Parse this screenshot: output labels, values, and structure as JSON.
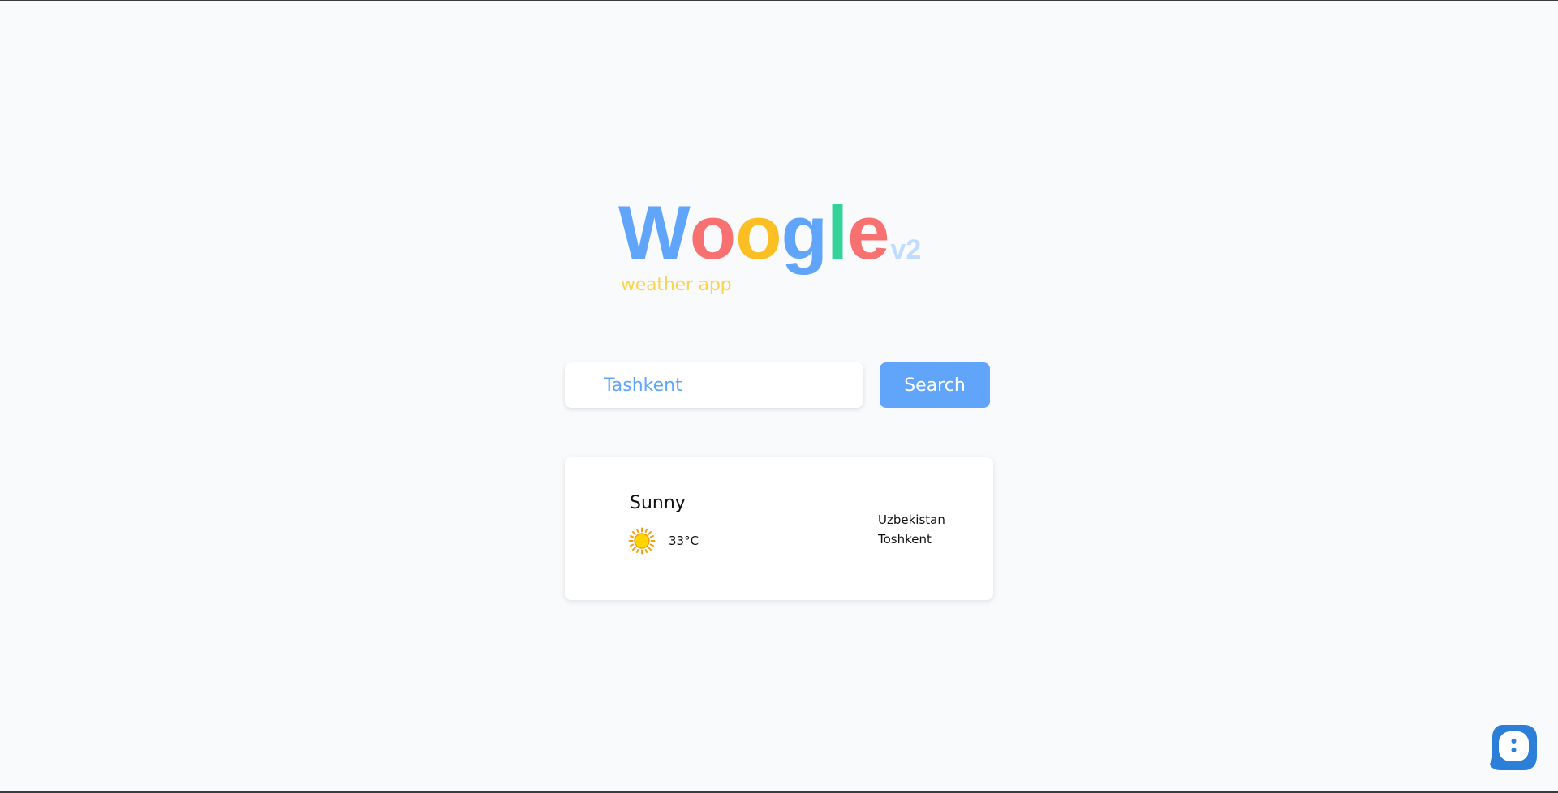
{
  "brand": {
    "letters": [
      "W",
      "o",
      "o",
      "g",
      "l",
      "e"
    ],
    "version": "v2",
    "tagline": "weather app"
  },
  "colors": {
    "blue": "#60a5fa",
    "red": "#f87171",
    "yellow": "#fbbf24",
    "green": "#34d399",
    "version": "#bfdbfe",
    "tagline": "#fcd34d",
    "button": "#60a5fa",
    "input_text": "#60a5fa",
    "help": "#2b7fd8"
  },
  "search": {
    "value": "Tashkent",
    "button_label": "Search"
  },
  "weather": {
    "condition": "Sunny",
    "icon": "sun-icon",
    "temperature": "33°C",
    "country": "Uzbekistan",
    "city": "Toshkent"
  },
  "help": {
    "icon": "chat-dots-icon"
  }
}
